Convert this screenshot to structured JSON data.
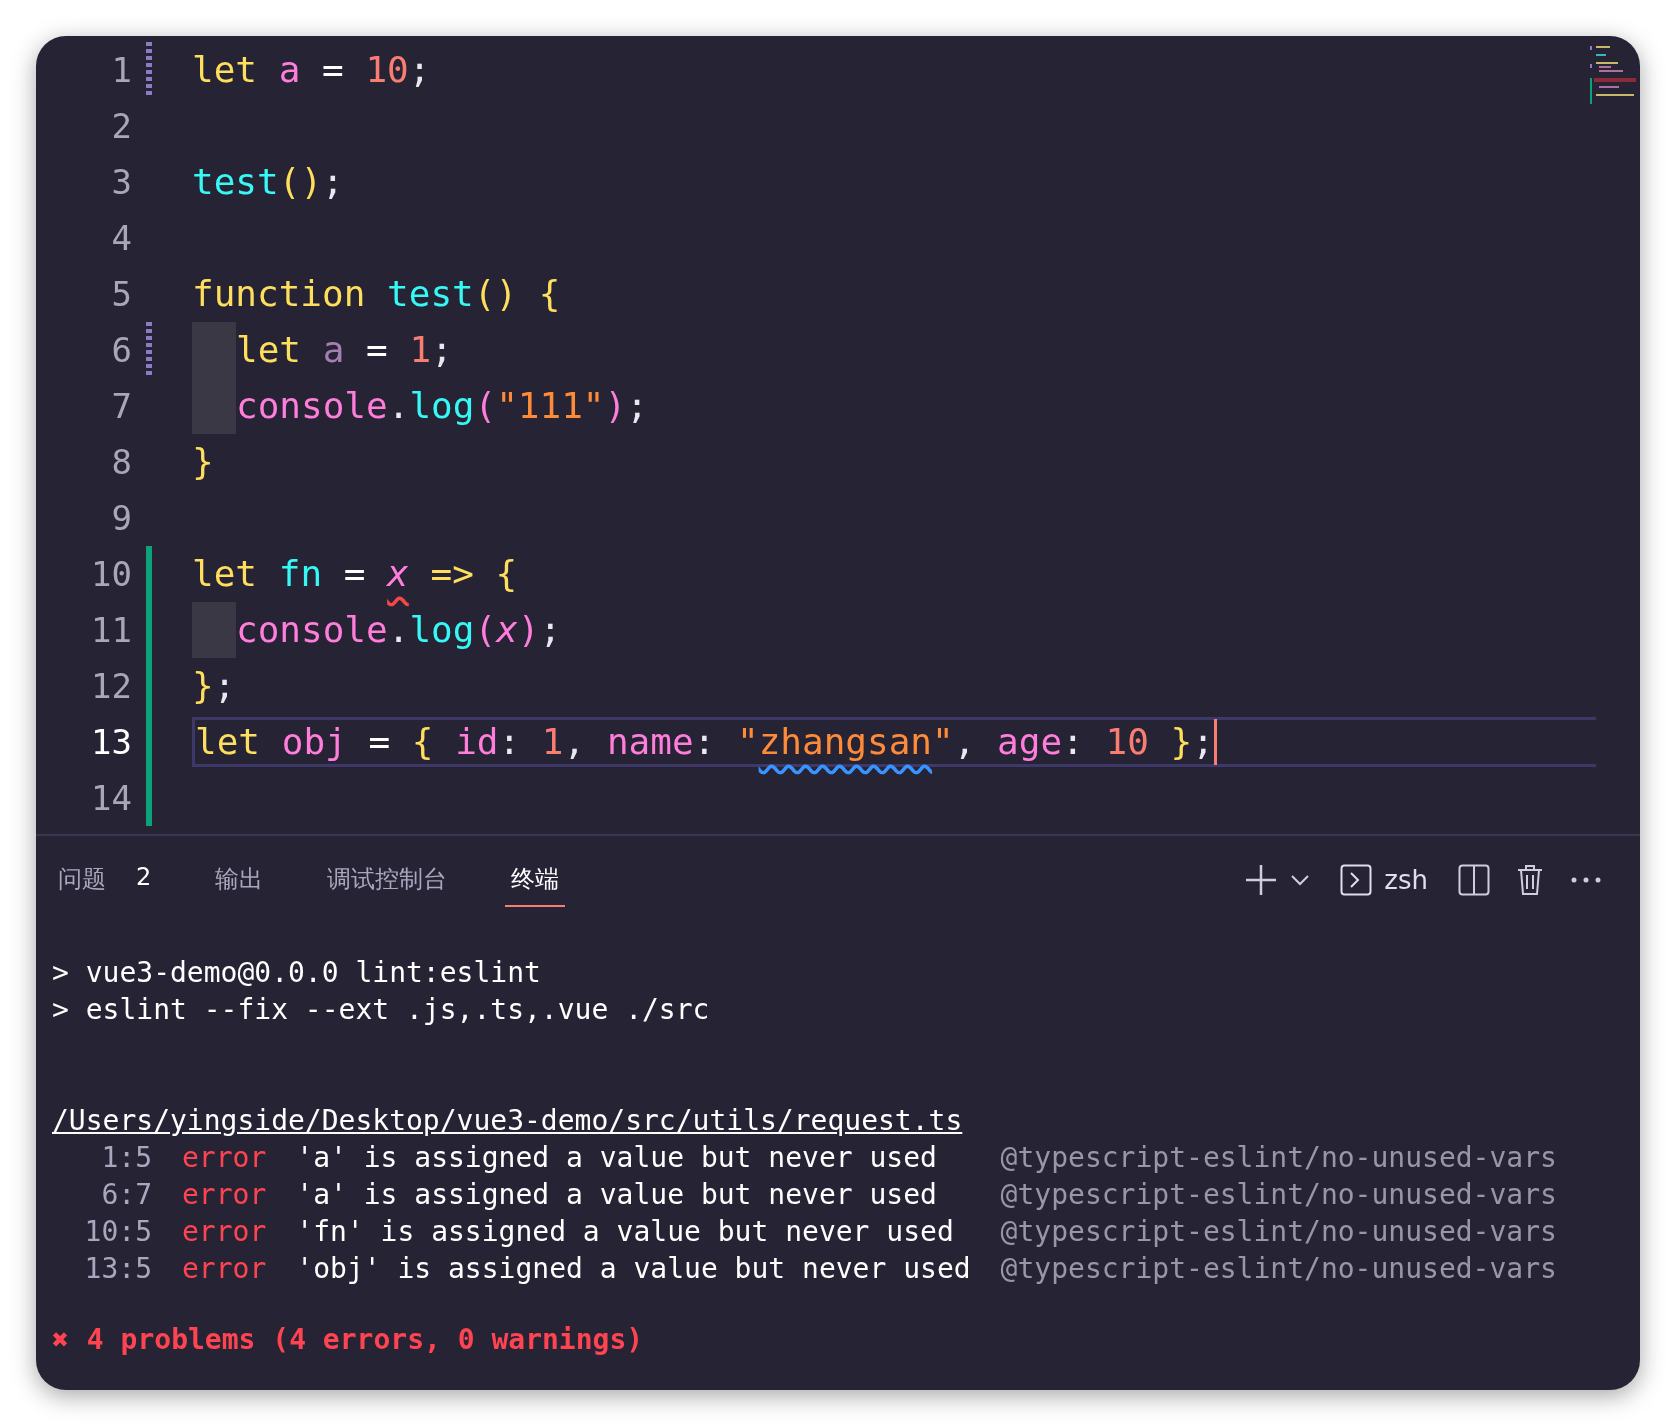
{
  "editor": {
    "lines": [
      {
        "number": "1",
        "modified": true,
        "added": false,
        "indent": false,
        "current": false,
        "tokens": [
          {
            "text": "let ",
            "kind": "keyword"
          },
          {
            "text": "a",
            "kind": "variable"
          },
          {
            "text": " = ",
            "kind": "operator"
          },
          {
            "text": "10",
            "kind": "number"
          },
          {
            "text": ";",
            "kind": "punct"
          }
        ]
      },
      {
        "number": "2",
        "modified": false,
        "added": false,
        "indent": false,
        "current": false
      },
      {
        "number": "3",
        "modified": false,
        "added": false,
        "indent": false,
        "current": false,
        "tokens": [
          {
            "text": "test",
            "kind": "function"
          },
          {
            "text": "()",
            "kind": "brace"
          },
          {
            "text": ";",
            "kind": "punct"
          }
        ]
      },
      {
        "number": "4",
        "modified": false,
        "added": false,
        "indent": false,
        "current": false
      },
      {
        "number": "5",
        "modified": false,
        "added": false,
        "indent": false,
        "current": false,
        "tokens": [
          {
            "text": "function ",
            "kind": "keyword"
          },
          {
            "text": "test",
            "kind": "function"
          },
          {
            "text": "() {",
            "kind": "brace"
          }
        ]
      },
      {
        "number": "6",
        "modified": true,
        "added": false,
        "indent": true,
        "current": false,
        "tokens": [
          {
            "text": "let ",
            "kind": "keyword"
          },
          {
            "text": "a",
            "kind": "unused"
          },
          {
            "text": " = ",
            "kind": "operator"
          },
          {
            "text": "1",
            "kind": "number"
          },
          {
            "text": ";",
            "kind": "punct"
          }
        ]
      },
      {
        "number": "7",
        "modified": false,
        "added": false,
        "indent": true,
        "current": false,
        "tokens": [
          {
            "text": "console",
            "kind": "variable"
          },
          {
            "text": ".",
            "kind": "punct"
          },
          {
            "text": "log",
            "kind": "function"
          },
          {
            "text": "(",
            "kind": "property"
          },
          {
            "text": "\"111\"",
            "kind": "string"
          },
          {
            "text": ")",
            "kind": "property"
          },
          {
            "text": ";",
            "kind": "punct"
          }
        ]
      },
      {
        "number": "8",
        "modified": false,
        "added": false,
        "indent": false,
        "current": false,
        "tokens": [
          {
            "text": "}",
            "kind": "brace"
          }
        ]
      },
      {
        "number": "9",
        "modified": false,
        "added": false,
        "indent": false,
        "current": false
      },
      {
        "number": "10",
        "modified": false,
        "added": true,
        "indent": false,
        "current": false,
        "tokens": [
          {
            "text": "let ",
            "kind": "keyword"
          },
          {
            "text": "fn",
            "kind": "function"
          },
          {
            "text": " = ",
            "kind": "operator"
          },
          {
            "text": "x",
            "kind": "param",
            "error": true
          },
          {
            "text": " => {",
            "kind": "brace"
          }
        ]
      },
      {
        "number": "11",
        "modified": false,
        "added": true,
        "indent": true,
        "current": false,
        "tokens": [
          {
            "text": "console",
            "kind": "variable"
          },
          {
            "text": ".",
            "kind": "punct"
          },
          {
            "text": "log",
            "kind": "function"
          },
          {
            "text": "(",
            "kind": "property"
          },
          {
            "text": "x",
            "kind": "param"
          },
          {
            "text": ")",
            "kind": "property"
          },
          {
            "text": ";",
            "kind": "punct"
          }
        ]
      },
      {
        "number": "12",
        "modified": false,
        "added": true,
        "indent": false,
        "current": false,
        "tokens": [
          {
            "text": "}",
            "kind": "brace"
          },
          {
            "text": ";",
            "kind": "punct"
          }
        ]
      },
      {
        "number": "13",
        "modified": false,
        "added": true,
        "indent": false,
        "current": true,
        "tokens": [
          {
            "text": "let ",
            "kind": "keyword"
          },
          {
            "text": "obj",
            "kind": "variable"
          },
          {
            "text": " = ",
            "kind": "operator"
          },
          {
            "text": "{ ",
            "kind": "brace"
          },
          {
            "text": "id",
            "kind": "property"
          },
          {
            "text": ": ",
            "kind": "punct"
          },
          {
            "text": "1",
            "kind": "number"
          },
          {
            "text": ", ",
            "kind": "punct"
          },
          {
            "text": "name",
            "kind": "property"
          },
          {
            "text": ": ",
            "kind": "punct"
          },
          {
            "text": "\"",
            "kind": "string"
          },
          {
            "text": "zhangsan",
            "kind": "string",
            "hint": true
          },
          {
            "text": "\"",
            "kind": "string"
          },
          {
            "text": ", ",
            "kind": "punct"
          },
          {
            "text": "age",
            "kind": "property"
          },
          {
            "text": ": ",
            "kind": "punct"
          },
          {
            "text": "10",
            "kind": "number"
          },
          {
            "text": " }",
            "kind": "brace"
          },
          {
            "text": ";",
            "kind": "punct"
          }
        ]
      },
      {
        "number": "14",
        "modified": false,
        "added": true,
        "indent": false,
        "current": false
      }
    ]
  },
  "panel": {
    "tabs": [
      {
        "label": "问题",
        "badge": "2",
        "selected": false
      },
      {
        "label": "输出",
        "selected": false
      },
      {
        "label": "调试控制台",
        "selected": false
      },
      {
        "label": "终端",
        "selected": true
      }
    ],
    "shell": "zsh"
  },
  "terminal": {
    "commands": [
      "> vue3-demo@0.0.0 lint:eslint",
      "> eslint --fix --ext .js,.ts,.vue ./src"
    ],
    "file": "/Users/yingside/Desktop/vue3-demo/src/utils/request.ts",
    "problems": [
      {
        "position": "1:5",
        "severity": "error",
        "message": "'a' is assigned a value but never used",
        "rule": "@typescript-eslint/no-unused-vars"
      },
      {
        "position": "6:7",
        "severity": "error",
        "message": "'a' is assigned a value but never used",
        "rule": "@typescript-eslint/no-unused-vars"
      },
      {
        "position": "10:5",
        "severity": "error",
        "message": "'fn' is assigned a value but never used",
        "rule": "@typescript-eslint/no-unused-vars"
      },
      {
        "position": "13:5",
        "severity": "error",
        "message": "'obj' is assigned a value but never used",
        "rule": "@typescript-eslint/no-unused-vars"
      }
    ],
    "summary_mark": "✖",
    "summary": "4 problems (4 errors, 0 warnings)"
  }
}
